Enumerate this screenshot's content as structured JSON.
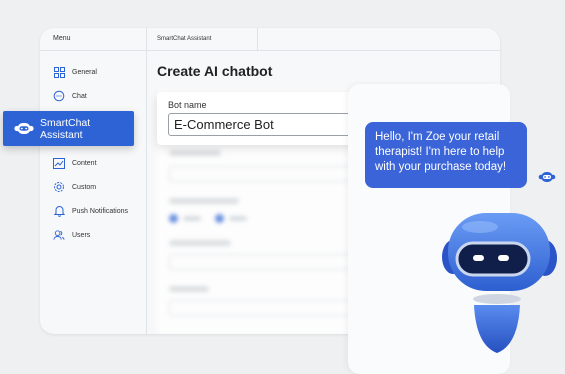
{
  "sidebar": {
    "title": "Menu",
    "items": [
      {
        "label": "General",
        "icon": "grid-icon"
      },
      {
        "label": "Chat",
        "icon": "chat-icon"
      },
      {
        "label": "Content",
        "icon": "chart-icon"
      },
      {
        "label": "Custom",
        "icon": "gear-icon"
      },
      {
        "label": "Push Notifications",
        "icon": "bell-icon"
      },
      {
        "label": "Users",
        "icon": "users-icon"
      }
    ]
  },
  "tab": {
    "label": "SmartChat Assistant"
  },
  "main": {
    "title": "Create AI chatbot"
  },
  "form": {
    "bot_name_label": "Bot name",
    "bot_name_value": "E-Commerce Bot"
  },
  "callout": {
    "label": "SmartChat Assistant",
    "icon": "robot-icon"
  },
  "preview": {
    "message": "Hello, I'm Zoe your retail therapist! I'm here to help with your purchase today!"
  },
  "colors": {
    "accent": "#2e63d5",
    "bubble": "#3a64d8",
    "background": "#eef0f2"
  }
}
